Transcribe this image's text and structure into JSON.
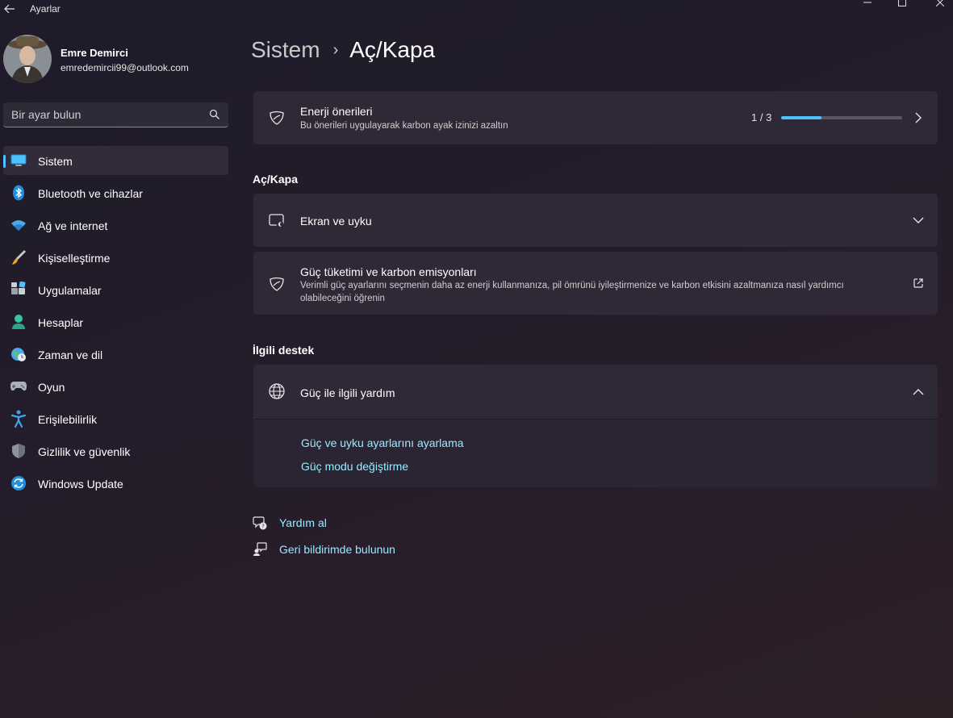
{
  "window": {
    "title": "Ayarlar"
  },
  "profile": {
    "name": "Emre Demirci",
    "email": "emredemircii99@outlook.com"
  },
  "search": {
    "placeholder": "Bir ayar bulun"
  },
  "sidebar": {
    "items": [
      {
        "label": "Sistem",
        "icon": "system-icon",
        "active": true
      },
      {
        "label": "Bluetooth ve cihazlar",
        "icon": "bluetooth-icon"
      },
      {
        "label": "Ağ ve internet",
        "icon": "wifi-icon"
      },
      {
        "label": "Kişiselleştirme",
        "icon": "brush-icon"
      },
      {
        "label": "Uygulamalar",
        "icon": "apps-icon"
      },
      {
        "label": "Hesaplar",
        "icon": "person-icon"
      },
      {
        "label": "Zaman ve dil",
        "icon": "globe-clock-icon"
      },
      {
        "label": "Oyun",
        "icon": "gamepad-icon"
      },
      {
        "label": "Erişilebilirlik",
        "icon": "accessibility-icon"
      },
      {
        "label": "Gizlilik ve güvenlik",
        "icon": "shield-icon"
      },
      {
        "label": "Windows Update",
        "icon": "update-icon"
      }
    ]
  },
  "breadcrumb": {
    "parent": "Sistem",
    "separator": "›",
    "current": "Aç/Kapa"
  },
  "energy": {
    "title": "Enerji önerileri",
    "description": "Bu önerileri uygulayarak karbon ayak izinizi azaltın",
    "progress_text": "1 / 3",
    "progress_fraction": 0.33
  },
  "section_power": {
    "title": "Aç/Kapa"
  },
  "screen_sleep": {
    "title": "Ekran ve uyku"
  },
  "power_carbon": {
    "title": "Güç tüketimi ve karbon emisyonları",
    "description": "Verimli güç ayarlarını seçmenin daha az enerji kullanmanıza, pil ömrünü iyileştirmenize ve karbon etkisini azaltmanıza nasıl yardımcı olabileceğini öğrenin"
  },
  "section_support": {
    "title": "İlgili destek"
  },
  "power_help": {
    "title": "Güç ile ilgili yardım",
    "links": [
      "Güç ve uyku ayarlarını ayarlama",
      "Güç modu değiştirme"
    ]
  },
  "footer": {
    "get_help": "Yardım al",
    "feedback": "Geri bildirimde bulunun"
  },
  "colors": {
    "accent": "#4cc2ff",
    "link": "#99ebff",
    "card": "#2e2837"
  }
}
